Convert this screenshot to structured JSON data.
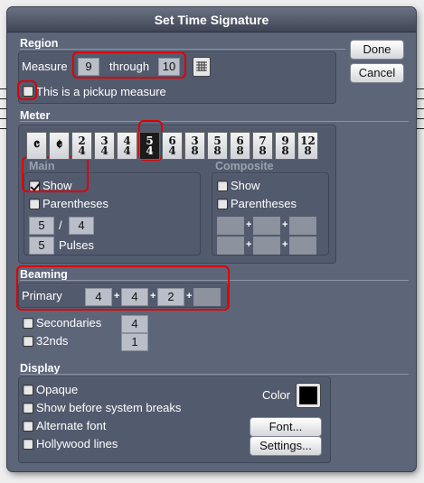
{
  "dialog": {
    "title": "Set Time Signature"
  },
  "buttons": {
    "done": "Done",
    "cancel": "Cancel",
    "font": "Font...",
    "settings": "Settings..."
  },
  "region": {
    "label": "Region",
    "measure_label": "Measure",
    "measure_from": "9",
    "through_label": "through",
    "measure_to": "10",
    "pickup_label": "This is a pickup measure",
    "pickup_checked": false
  },
  "meter": {
    "label": "Meter",
    "palette": [
      {
        "sym": "𝄴"
      },
      {
        "sym": "𝄵"
      },
      {
        "top": "2",
        "bottom": "4"
      },
      {
        "top": "3",
        "bottom": "4"
      },
      {
        "top": "4",
        "bottom": "4"
      },
      {
        "top": "5",
        "bottom": "4",
        "selected": true
      },
      {
        "top": "6",
        "bottom": "4"
      },
      {
        "top": "3",
        "bottom": "8"
      },
      {
        "top": "5",
        "bottom": "8"
      },
      {
        "top": "6",
        "bottom": "8"
      },
      {
        "top": "7",
        "bottom": "8"
      },
      {
        "top": "9",
        "bottom": "8"
      },
      {
        "top": "12",
        "bottom": "8"
      }
    ],
    "main": {
      "label": "Main",
      "show_label": "Show",
      "show_checked": true,
      "parentheses_label": "Parentheses",
      "top": "5",
      "slash": "/",
      "bottom": "4",
      "pulses": "5",
      "pulses_label": "Pulses"
    },
    "composite": {
      "label": "Composite",
      "show_label": "Show",
      "parentheses_label": "Parentheses"
    }
  },
  "beaming": {
    "label": "Beaming",
    "primary_label": "Primary",
    "primary": [
      "4",
      "4",
      "2",
      ""
    ],
    "plus": "+",
    "secondaries_label": "Secondaries",
    "secondaries": "4",
    "thirtyseconds_label": "32nds",
    "thirtyseconds": "1"
  },
  "display": {
    "label": "Display",
    "opaque": "Opaque",
    "show_before_breaks": "Show before system breaks",
    "alternate_font": "Alternate font",
    "hollywood": "Hollywood lines",
    "color_label": "Color",
    "color": "#000000"
  }
}
